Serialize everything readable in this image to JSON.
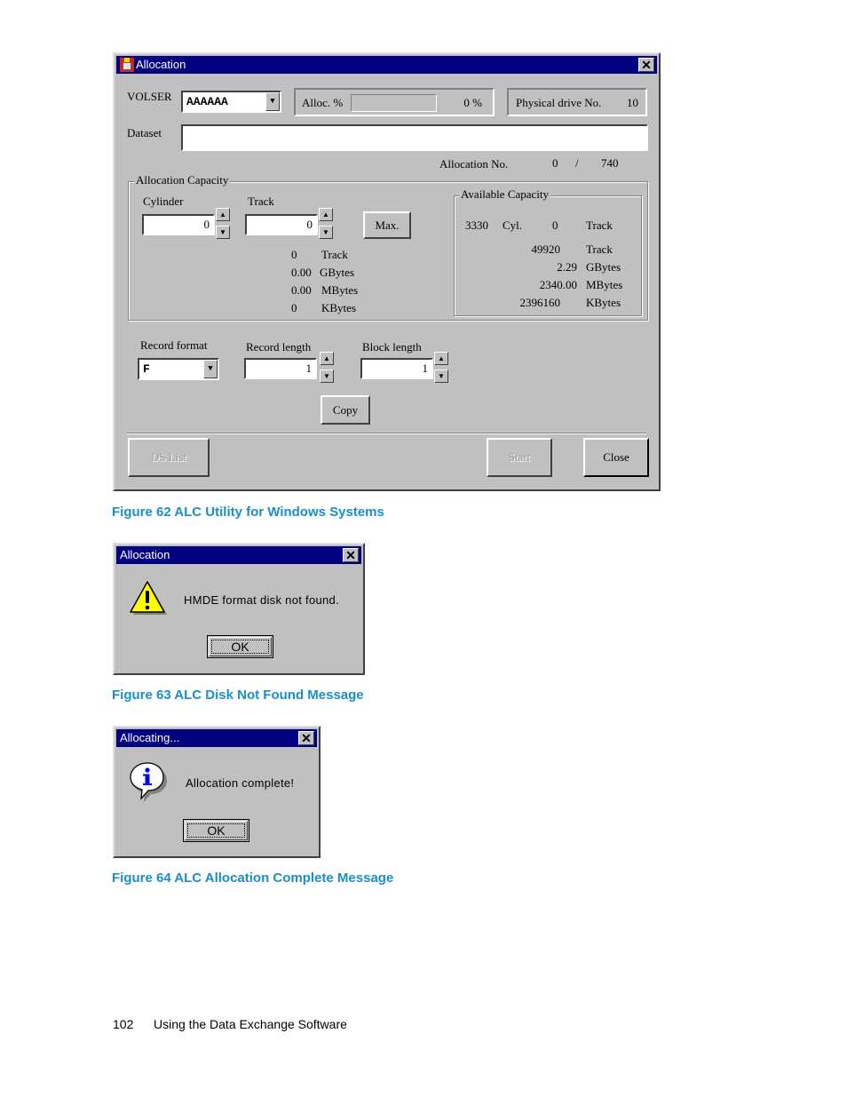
{
  "figure62": {
    "window_title": "Allocation",
    "volser_label": "VOLSER",
    "volser_value": "AAAAAA",
    "alloc_pct_label": "Alloc. %",
    "alloc_pct_value": "0 %",
    "alloc_progress_percent": 0,
    "physical_drive_label": "Physical drive No.",
    "physical_drive_value": "10",
    "dataset_label": "Dataset",
    "dataset_value": "",
    "allocation_no_label": "Allocation No.",
    "allocation_no_current": "0",
    "allocation_no_sep": "/",
    "allocation_no_total": "740",
    "alloc_capacity": {
      "title": "Allocation Capacity",
      "cylinder_label": "Cylinder",
      "cylinder_value": "0",
      "track_label": "Track",
      "track_value": "0",
      "max_button": "Max.",
      "rows": [
        {
          "value": "0",
          "unit": "Track"
        },
        {
          "value": "0.00",
          "unit": "GBytes"
        },
        {
          "value": "0.00",
          "unit": "MBytes"
        },
        {
          "value": "0",
          "unit": "KBytes"
        }
      ]
    },
    "available_capacity": {
      "title": "Available Capacity",
      "cyl_value": "3330",
      "cyl_unit": "Cyl.",
      "track_value": "0",
      "track_unit": "Track",
      "rows": [
        {
          "value": "49920",
          "unit": "Track"
        },
        {
          "value": "2.29",
          "unit": "GBytes"
        },
        {
          "value": "2340.00",
          "unit": "MBytes"
        },
        {
          "value": "2396160",
          "unit": "KBytes"
        }
      ]
    },
    "record_format_label": "Record format",
    "record_format_value": "F",
    "record_length_label": "Record length",
    "record_length_value": "1",
    "block_length_label": "Block length",
    "block_length_value": "1",
    "copy_button": "Copy",
    "ds_list_button": "DS List",
    "start_button": "Start",
    "close_button": "Close",
    "caption": "Figure 62 ALC Utility for Windows Systems"
  },
  "figure63": {
    "window_title": "Allocation",
    "message": "HMDE format disk not found.",
    "icon": "warning-icon",
    "ok_button": "OK",
    "caption": "Figure 63 ALC Disk Not Found Message"
  },
  "figure64": {
    "window_title": "Allocating...",
    "message": "Allocation complete!",
    "icon": "info-icon",
    "ok_button": "OK",
    "caption": "Figure 64 ALC Allocation Complete Message"
  },
  "footer": {
    "page_number": "102",
    "section_title": "Using the Data Exchange Software"
  },
  "colors": {
    "titlebar": "#000080",
    "window_face": "#c0c0c0",
    "caption": "#1a8fc6"
  }
}
